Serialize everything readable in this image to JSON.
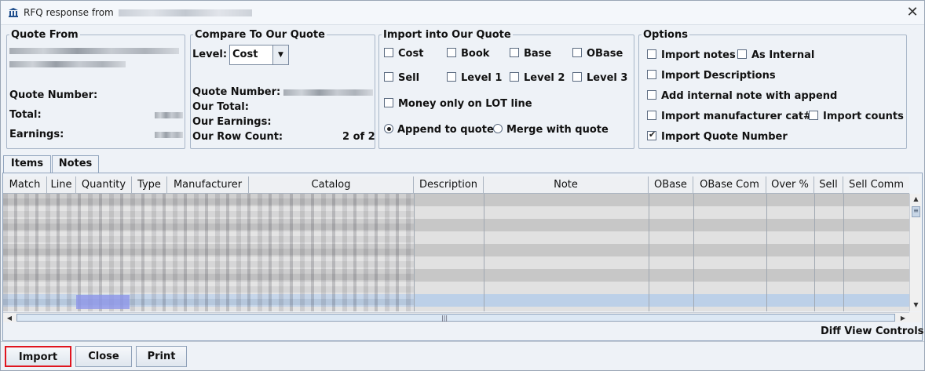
{
  "window": {
    "title": "RFQ response from"
  },
  "quote_from": {
    "legend": "Quote From",
    "number_label": "Quote Number:",
    "total_label": "Total:",
    "earnings_label": "Earnings:"
  },
  "compare": {
    "legend": "Compare To Our Quote",
    "level_label": "Level:",
    "level_value": "Cost",
    "quote_number_label": "Quote Number:",
    "our_total_label": "Our Total:",
    "our_earnings_label": "Our Earnings:",
    "row_count_label": "Our Row Count:",
    "row_count_value": "2 of 2"
  },
  "import_into": {
    "legend": "Import into Our Quote",
    "checks": [
      {
        "label": "Cost",
        "checked": false
      },
      {
        "label": "Book",
        "checked": false
      },
      {
        "label": "Base",
        "checked": false
      },
      {
        "label": "OBase",
        "checked": false
      },
      {
        "label": "Sell",
        "checked": false
      },
      {
        "label": "Level 1",
        "checked": false
      },
      {
        "label": "Level 2",
        "checked": false
      },
      {
        "label": "Level 3",
        "checked": false
      }
    ],
    "money_only": {
      "label": "Money only on LOT line",
      "checked": false
    },
    "append_label": "Append to quote",
    "merge_label": "Merge with quote",
    "selected_mode": "append"
  },
  "options": {
    "legend": "Options",
    "import_notes": {
      "label": "Import notes",
      "checked": false
    },
    "as_internal": {
      "label": "As Internal",
      "checked": false
    },
    "import_descriptions": {
      "label": "Import Descriptions",
      "checked": false
    },
    "internal_note": {
      "label": "Add internal note with append",
      "checked": false
    },
    "import_mfr_cat": {
      "label": "Import manufacturer cat#",
      "checked": false
    },
    "import_counts": {
      "label": "Import counts",
      "checked": false
    },
    "import_quote_number": {
      "label": "Import Quote Number",
      "checked": true
    }
  },
  "tabs": [
    {
      "label": "Items",
      "active": true
    },
    {
      "label": "Notes",
      "active": false
    }
  ],
  "table": {
    "columns": [
      "Match",
      "Line",
      "Quantity",
      "Type",
      "Manufacturer",
      "Catalog",
      "Description",
      "Note",
      "OBase",
      "OBase Com",
      "Over %",
      "Sell",
      "Sell Comm"
    ]
  },
  "diff_view_label": "Diff View Controls",
  "buttons": {
    "import": "Import",
    "close": "Close",
    "print": "Print"
  },
  "colors": {
    "highlight_border": "#e0141e",
    "selected_row": "#bcd0e8"
  }
}
